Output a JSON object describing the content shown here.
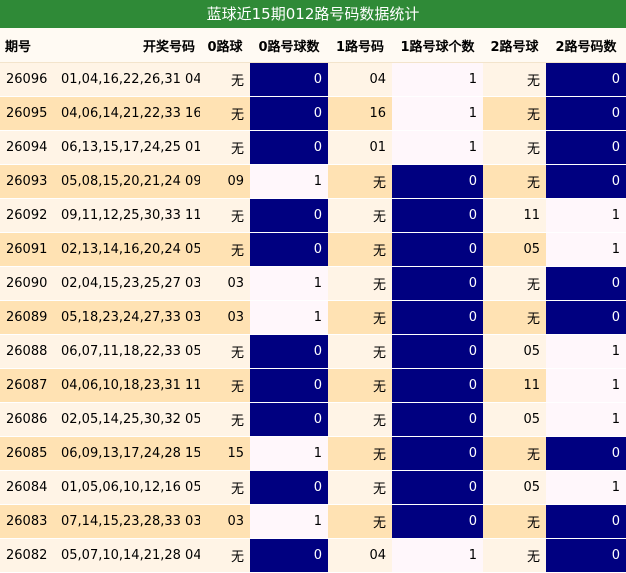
{
  "title": "蓝球近15期012路号码数据统计",
  "columns": [
    "期号",
    "开奖号码",
    "0路球",
    "0路号球数",
    "1路号码",
    "1路号球个数",
    "2路号球",
    "2路号码数"
  ],
  "rows": [
    {
      "issue": "26096",
      "nums": "01,04,16,22,26,31 04",
      "r0": "无",
      "c0": "0",
      "r1": "04",
      "c1": "1",
      "r2": "无",
      "c2": "0"
    },
    {
      "issue": "26095",
      "nums": "04,06,14,21,22,33 16",
      "r0": "无",
      "c0": "0",
      "r1": "16",
      "c1": "1",
      "r2": "无",
      "c2": "0"
    },
    {
      "issue": "26094",
      "nums": "06,13,15,17,24,25 01",
      "r0": "无",
      "c0": "0",
      "r1": "01",
      "c1": "1",
      "r2": "无",
      "c2": "0"
    },
    {
      "issue": "26093",
      "nums": "05,08,15,20,21,24 09",
      "r0": "09",
      "c0": "1",
      "r1": "无",
      "c1": "0",
      "r2": "无",
      "c2": "0"
    },
    {
      "issue": "26092",
      "nums": "09,11,12,25,30,33 11",
      "r0": "无",
      "c0": "0",
      "r1": "无",
      "c1": "0",
      "r2": "11",
      "c2": "1"
    },
    {
      "issue": "26091",
      "nums": "02,13,14,16,20,24 05",
      "r0": "无",
      "c0": "0",
      "r1": "无",
      "c1": "0",
      "r2": "05",
      "c2": "1"
    },
    {
      "issue": "26090",
      "nums": "02,04,15,23,25,27 03",
      "r0": "03",
      "c0": "1",
      "r1": "无",
      "c1": "0",
      "r2": "无",
      "c2": "0"
    },
    {
      "issue": "26089",
      "nums": "05,18,23,24,27,33 03",
      "r0": "03",
      "c0": "1",
      "r1": "无",
      "c1": "0",
      "r2": "无",
      "c2": "0"
    },
    {
      "issue": "26088",
      "nums": "06,07,11,18,22,33 05",
      "r0": "无",
      "c0": "0",
      "r1": "无",
      "c1": "0",
      "r2": "05",
      "c2": "1"
    },
    {
      "issue": "26087",
      "nums": "04,06,10,18,23,31 11",
      "r0": "无",
      "c0": "0",
      "r1": "无",
      "c1": "0",
      "r2": "11",
      "c2": "1"
    },
    {
      "issue": "26086",
      "nums": "02,05,14,25,30,32 05",
      "r0": "无",
      "c0": "0",
      "r1": "无",
      "c1": "0",
      "r2": "05",
      "c2": "1"
    },
    {
      "issue": "26085",
      "nums": "06,09,13,17,24,28 15",
      "r0": "15",
      "c0": "1",
      "r1": "无",
      "c1": "0",
      "r2": "无",
      "c2": "0"
    },
    {
      "issue": "26084",
      "nums": "01,05,06,10,12,16 05",
      "r0": "无",
      "c0": "0",
      "r1": "无",
      "c1": "0",
      "r2": "05",
      "c2": "1"
    },
    {
      "issue": "26083",
      "nums": "07,14,15,23,28,33 03",
      "r0": "03",
      "c0": "1",
      "r1": "无",
      "c1": "0",
      "r2": "无",
      "c2": "0"
    },
    {
      "issue": "26082",
      "nums": "05,07,10,14,21,28 04",
      "r0": "无",
      "c0": "0",
      "r1": "04",
      "c1": "1",
      "r2": "无",
      "c2": "0"
    }
  ],
  "colors": {
    "title_bg": "#2f8a37",
    "row_light": "#fff4e6",
    "row_dark": "#ffe2b3",
    "zero_count_highlight": "#000080",
    "nonzero_count_bg": "#fff7fb"
  }
}
